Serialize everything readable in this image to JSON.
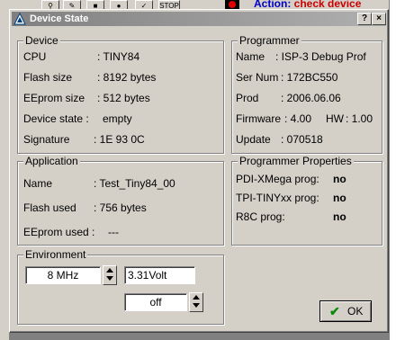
{
  "dialog": {
    "title": "Device State",
    "help_button": "?",
    "close_button": "×"
  },
  "background": {
    "action_label": "Action:",
    "action_value": "check device",
    "stop_label": "STOP"
  },
  "device": {
    "legend": "Device",
    "rows": [
      {
        "label": "CPU",
        "value": ": TINY84"
      },
      {
        "label": "Flash size",
        "value": ": 8192 bytes"
      },
      {
        "label": "EEprom size",
        "value": ": 512 bytes"
      },
      {
        "label": "Device state  :",
        "value": "empty"
      },
      {
        "label": "Signature",
        "value": ": 1E 93 0C"
      }
    ]
  },
  "programmer": {
    "legend": "Programmer",
    "name_label": "Name",
    "name_value": ":  ISP-3 Debug Prof",
    "sernum_label": "Ser Num",
    "sernum_value": ":  172BC550",
    "prod_label": "Prod",
    "prod_value": ":  2006.06.06",
    "firmware_label": "Firmware",
    "firmware_value": ": 4.00",
    "hw_label": "HW",
    "hw_value": ": 1.00",
    "update_label": "Update",
    "update_value": ": 070518"
  },
  "application": {
    "legend": "Application",
    "rows": [
      {
        "label": "Name",
        "value": ":  Test_Tiny84_00"
      },
      {
        "label": "Flash used",
        "value": ":  756 bytes"
      },
      {
        "label": "EEprom used :",
        "value": "---"
      }
    ]
  },
  "programmer_properties": {
    "legend": "Programmer Properties",
    "rows": [
      {
        "label": "PDI-XMega prog:",
        "value": "no"
      },
      {
        "label": "TPI-TINYxx prog:",
        "value": "no"
      },
      {
        "label": "R8C prog:",
        "value": "no"
      }
    ]
  },
  "environment": {
    "legend": "Environment",
    "clock_value": "8 MHz",
    "voltage_value": "3.31Volt",
    "power_value": "off"
  },
  "ok_button": {
    "label": "OK"
  },
  "colors": {
    "dialog_face": "#d4d0c8",
    "title_gradient_start": "#808080",
    "ok_check": "#0a8a0a",
    "action_blue": "#0000cc",
    "action_red": "#cc0000"
  }
}
